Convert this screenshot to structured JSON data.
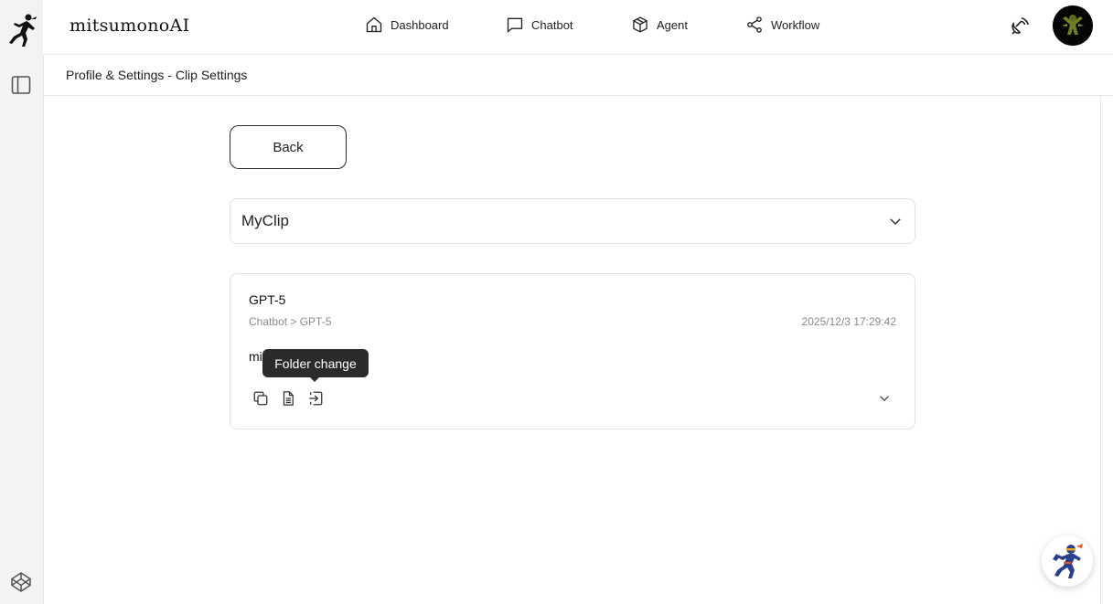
{
  "brand": {
    "name": "mitsumonoAI"
  },
  "nav": [
    {
      "label": "Dashboard",
      "icon": "home-icon"
    },
    {
      "label": "Chatbot",
      "icon": "chat-bubble-icon"
    },
    {
      "label": "Agent",
      "icon": "cube-icon"
    },
    {
      "label": "Workflow",
      "icon": "share-nodes-icon"
    }
  ],
  "breadcrumb": "Profile & Settings - Clip Settings",
  "back_label": "Back",
  "folder_select": {
    "value": "MyClip"
  },
  "clip": {
    "title": "GPT-5",
    "path": "Chatbot > GPT-5",
    "timestamp": "2025/12/3 17:29:42",
    "preview": "mi"
  },
  "tooltip": "Folder change",
  "colors": {
    "text": "#1f1f1f",
    "muted": "#8a8a8e",
    "border": "#e2e2e4",
    "sidebar": "#f3f3f4",
    "tooltip": "#2b2b2b"
  }
}
